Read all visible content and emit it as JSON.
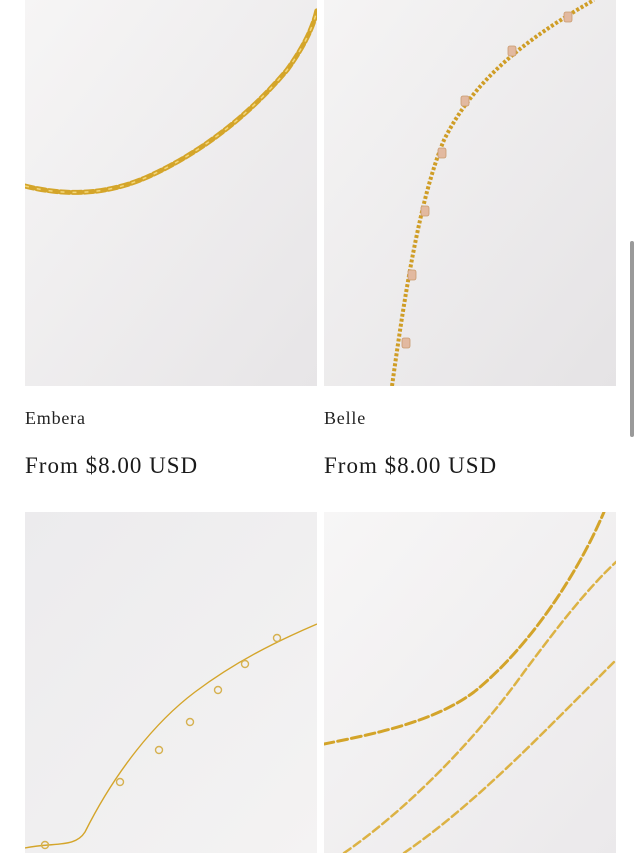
{
  "products": [
    {
      "name": "Embera",
      "price": "From $8.00 USD",
      "image_icon": "figaro-chain-necklace-photo"
    },
    {
      "name": "Belle",
      "price": "From $8.00 USD",
      "image_icon": "station-chain-necklace-photo"
    },
    {
      "name": "",
      "price": "",
      "image_icon": "crystal-station-chain-photo"
    },
    {
      "name": "",
      "price": "",
      "image_icon": "paperclip-chain-necklace-photo"
    }
  ],
  "colors": {
    "gold": "#d9ad2e",
    "gold_light": "#ebc75a",
    "background": "#ffffff",
    "photo_bg": "#eeeded"
  }
}
